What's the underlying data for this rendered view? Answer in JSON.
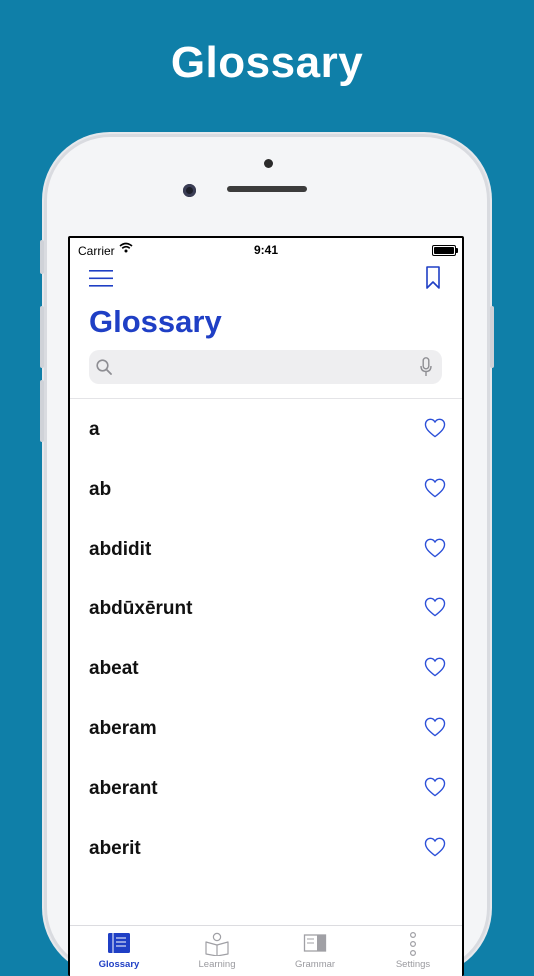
{
  "promo": {
    "headline": "Glossary"
  },
  "status_bar": {
    "carrier": "Carrier",
    "time": "9:41"
  },
  "header": {
    "title": "Glossary"
  },
  "search": {
    "placeholder": ""
  },
  "words": [
    {
      "label": "a"
    },
    {
      "label": "ab"
    },
    {
      "label": "abdidit"
    },
    {
      "label": "abdūxērunt"
    },
    {
      "label": "abeat"
    },
    {
      "label": "aberam"
    },
    {
      "label": "aberant"
    },
    {
      "label": "aberit"
    }
  ],
  "tabs": [
    {
      "label": "Glossary",
      "icon": "glossary-book-icon",
      "active": true
    },
    {
      "label": "Learning",
      "icon": "learning-reader-icon",
      "active": false
    },
    {
      "label": "Grammar",
      "icon": "grammar-book-icon",
      "active": false
    },
    {
      "label": "Settings",
      "icon": "settings-dots-icon",
      "active": false
    }
  ],
  "colors": {
    "background": "#0F7FA8",
    "accent": "#1F3FC5",
    "heart_outline": "#2B4FD8"
  }
}
